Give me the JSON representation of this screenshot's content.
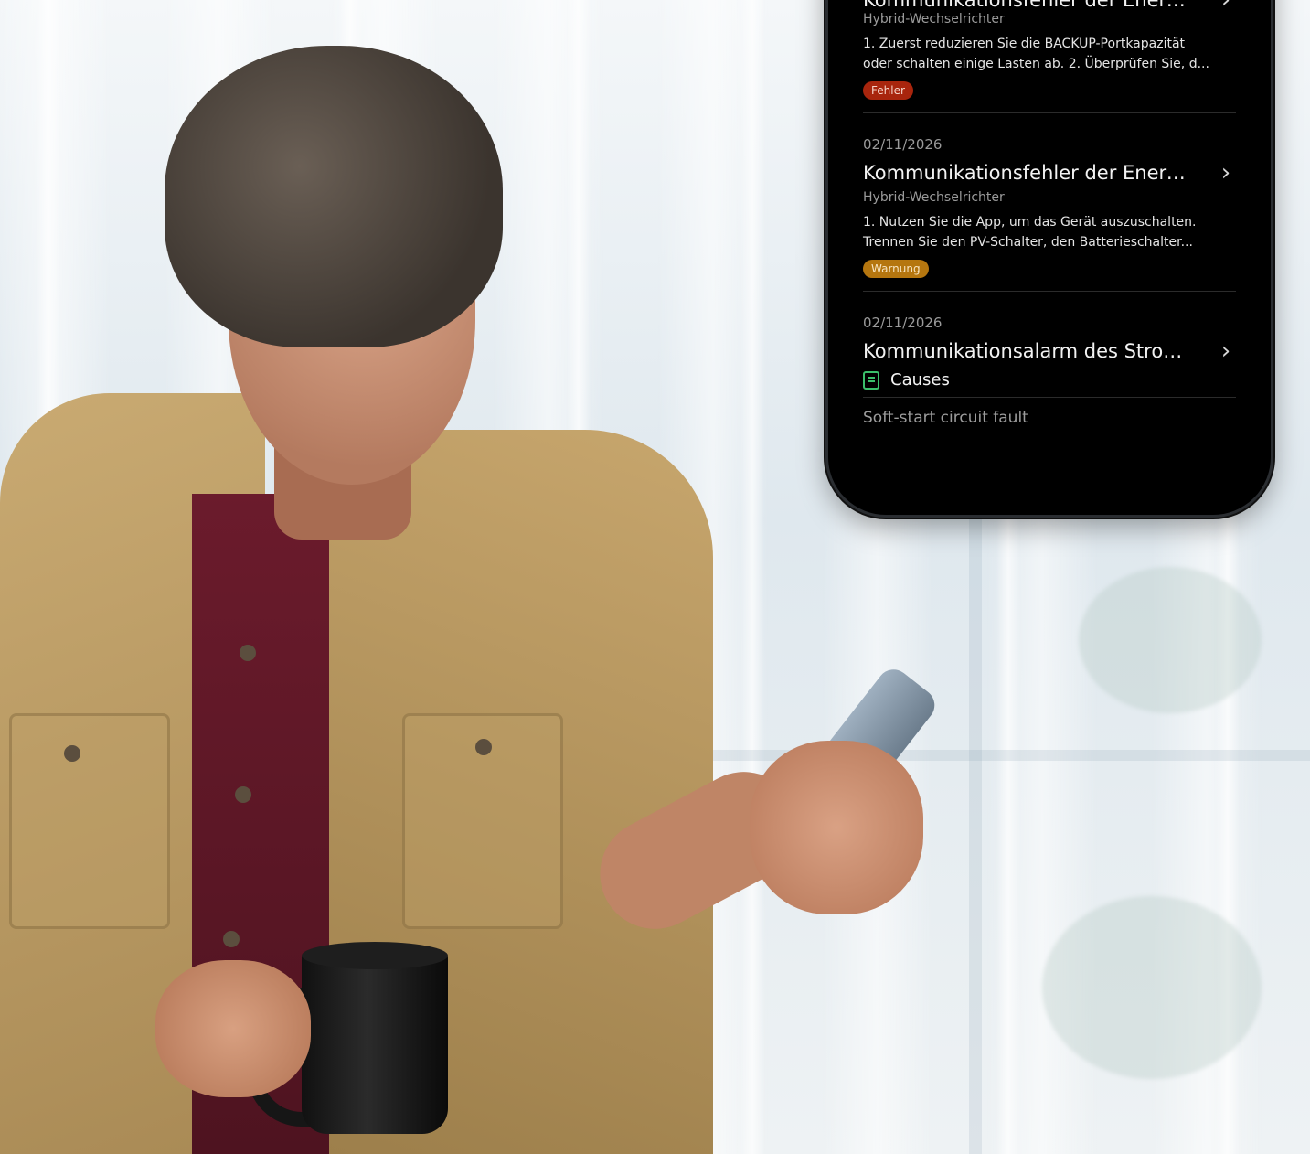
{
  "phone": {
    "items": [
      {
        "title": "Kommunikationsfehler der Energiespeicher",
        "device": "Hybrid-Wechselrichter",
        "description_line1": "1. Zuerst reduzieren Sie die BACKUP-Portkapazität",
        "description_line2": "oder schalten einige Lasten ab. 2. Überprüfen Sie, d...",
        "badge": "Fehler"
      },
      {
        "date": "02/11/2026",
        "title": "Kommunikationsfehler der Energies...",
        "device": "Hybrid-Wechselrichter",
        "description_line1": "1. Nutzen Sie die App, um das Gerät auszuschalten.",
        "description_line2": "Trennen Sie den PV-Schalter, den Batterieschalter...",
        "badge": "Warnung"
      },
      {
        "date": "02/11/2026",
        "title": "Kommunikationsalarm des Stromzä...",
        "causes_label": "Causes",
        "cause": "Soft-start circuit fault"
      }
    ],
    "chevron": "›"
  },
  "colors": {
    "error_badge": "#a8250d",
    "warning_badge": "#b5760f",
    "causes_icon": "#3bbf6b"
  }
}
